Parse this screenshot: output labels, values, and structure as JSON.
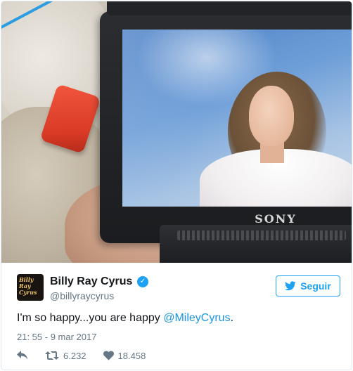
{
  "photo": {
    "camera_brand": "SONY"
  },
  "tweet": {
    "avatar_text": "Billy Ray Cyrus",
    "display_name": "Billy Ray Cyrus",
    "handle": "@billyraycyrus",
    "follow_label": "Seguir",
    "text_main": "I'm so happy...you are happy ",
    "text_mention": "@MileyCyrus",
    "text_end": ".",
    "timestamp": "21: 55 - 9 mar 2017",
    "retweets": "6.232",
    "likes": "18.458"
  },
  "icons": {
    "verified": "verified-badge-icon",
    "follow": "twitter-bird-icon",
    "reply": "reply-icon",
    "retweet": "retweet-icon",
    "like": "heart-icon"
  },
  "colors": {
    "accent": "#1da1f2",
    "mention": "#1b95e0",
    "muted": "#657786",
    "text": "#14171a"
  }
}
